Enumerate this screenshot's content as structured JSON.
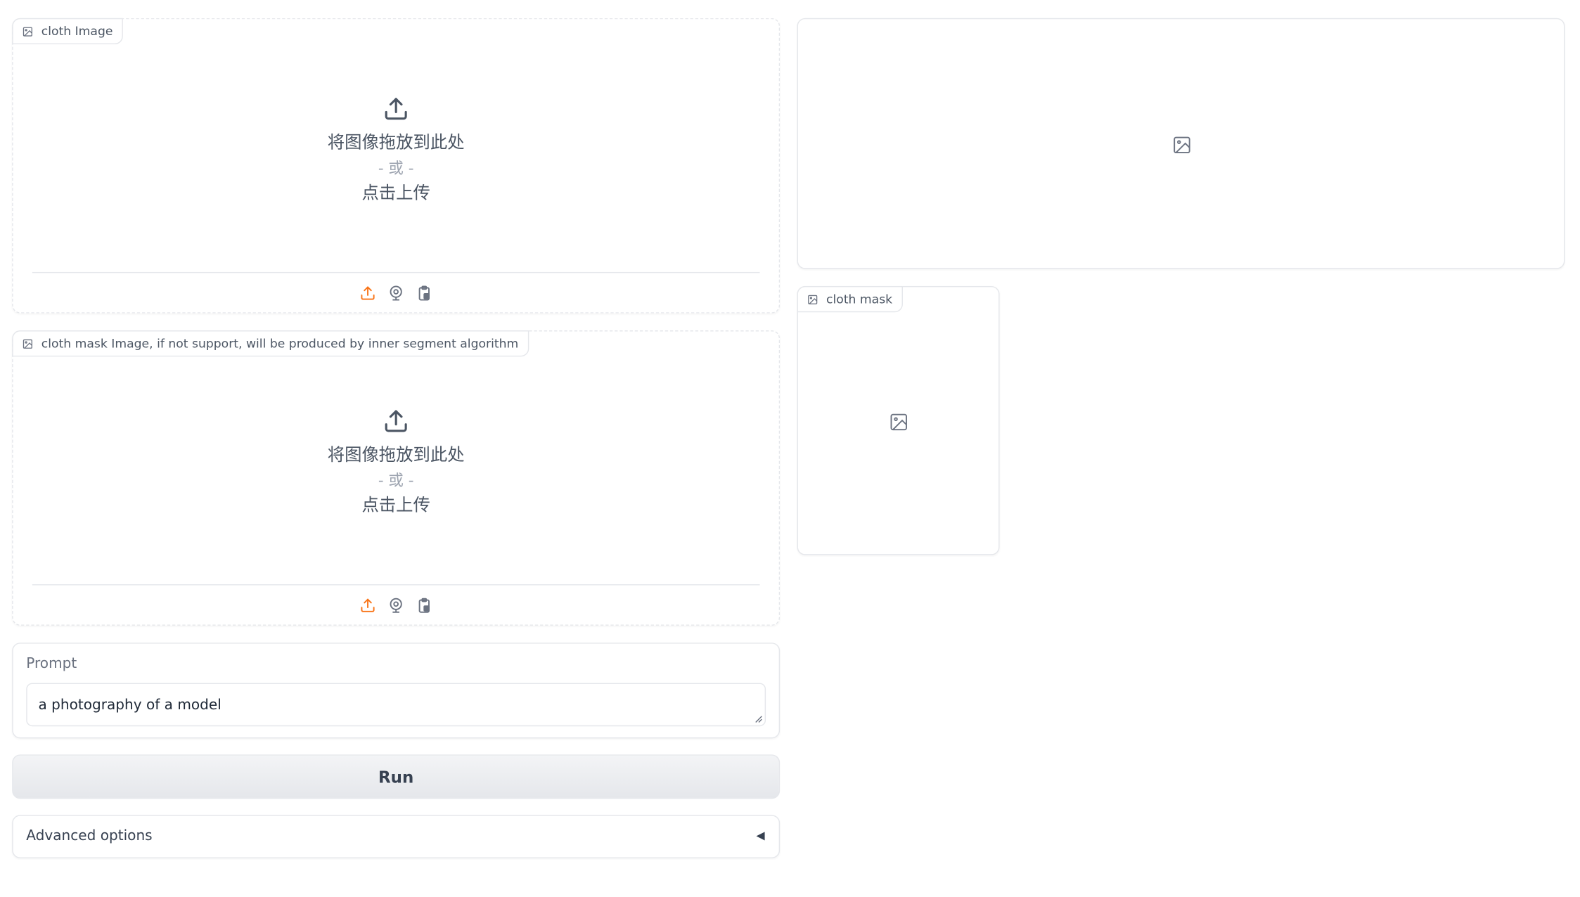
{
  "cloth_image": {
    "label": "cloth Image",
    "drop_text": "将图像拖放到此处",
    "or_text": "- 或 -",
    "click_text": "点击上传"
  },
  "cloth_mask_image": {
    "label": "cloth mask Image, if not support, will be produced by inner segment algorithm",
    "drop_text": "将图像拖放到此处",
    "or_text": "- 或 -",
    "click_text": "点击上传"
  },
  "prompt": {
    "label": "Prompt",
    "value": "a photography of a model"
  },
  "run_button": "Run",
  "advanced": {
    "label": "Advanced options",
    "caret": "◀"
  },
  "output_mask": {
    "label": "cloth mask"
  },
  "colors": {
    "accent": "#f97316",
    "border": "#e5e7eb",
    "text": "#374151"
  }
}
